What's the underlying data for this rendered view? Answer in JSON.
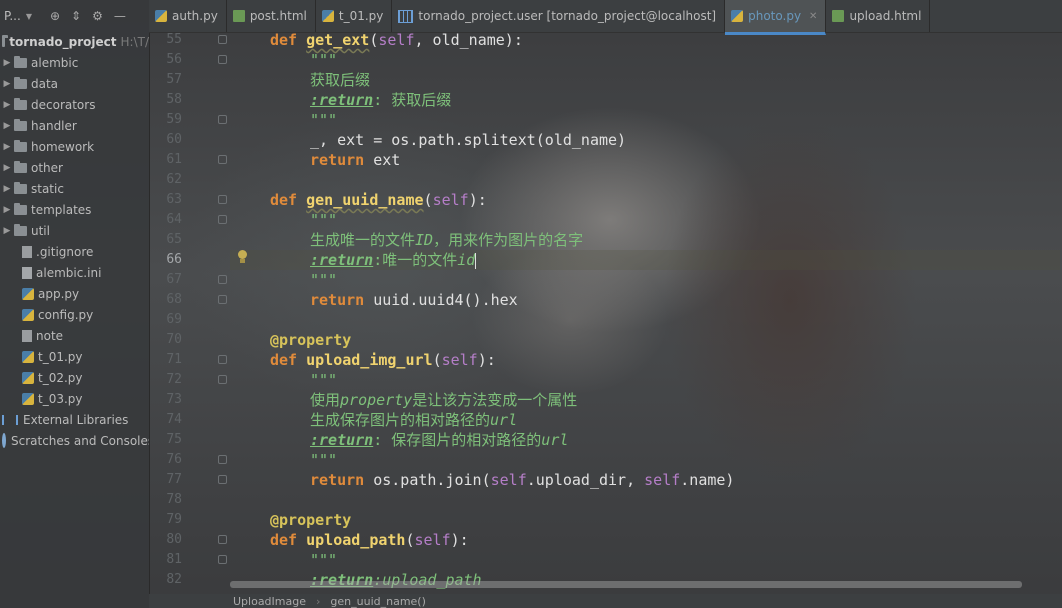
{
  "sidebar": {
    "header_title": "P...",
    "project": {
      "name": "tornado_project",
      "path": "H:\\T/"
    },
    "items": [
      {
        "label": "alembic",
        "type": "folder"
      },
      {
        "label": "data",
        "type": "folder"
      },
      {
        "label": "decorators",
        "type": "folder"
      },
      {
        "label": "handler",
        "type": "folder"
      },
      {
        "label": "homework",
        "type": "folder"
      },
      {
        "label": "other",
        "type": "folder"
      },
      {
        "label": "static",
        "type": "folder"
      },
      {
        "label": "templates",
        "type": "folder"
      },
      {
        "label": "util",
        "type": "folder"
      },
      {
        "label": ".gitignore",
        "type": "file"
      },
      {
        "label": "alembic.ini",
        "type": "ini"
      },
      {
        "label": "app.py",
        "type": "py"
      },
      {
        "label": "config.py",
        "type": "py"
      },
      {
        "label": "note",
        "type": "file"
      },
      {
        "label": "t_01.py",
        "type": "py"
      },
      {
        "label": "t_02.py",
        "type": "py"
      },
      {
        "label": "t_03.py",
        "type": "py"
      }
    ],
    "external_libraries": "External Libraries",
    "scratches": "Scratches and Consoles"
  },
  "tabs": [
    {
      "label": "auth.py",
      "icon": "python-file-icon",
      "active": false
    },
    {
      "label": "post.html",
      "icon": "html-file-icon",
      "active": false
    },
    {
      "label": "t_01.py",
      "icon": "python-file-icon",
      "active": false
    },
    {
      "label": "tornado_project.user [tornado_project@localhost]",
      "icon": "database-table-icon",
      "active": false
    },
    {
      "label": "photo.py",
      "icon": "python-file-icon",
      "active": true
    },
    {
      "label": "upload.html",
      "icon": "html-file-icon",
      "active": false
    }
  ],
  "editor": {
    "line_numbers": [
      "55",
      "56",
      "57",
      "58",
      "59",
      "60",
      "61",
      "62",
      "63",
      "64",
      "65",
      "66",
      "67",
      "68",
      "69",
      "70",
      "71",
      "72",
      "73",
      "74",
      "75",
      "76",
      "77",
      "78",
      "79",
      "80",
      "81",
      "82"
    ],
    "current_line": "66",
    "code": {
      "l55_def": "def ",
      "l55_name": "get_ext",
      "l55_open": "(",
      "l55_self": "self",
      "l55_rest": ", old_name):",
      "l56": "\"\"\"",
      "l57": "获取后缀",
      "l58_tag": ":return",
      "l58_text": ": 获取后缀",
      "l59": "\"\"\"",
      "l60": "_, ext = os.path.splitext(old_name)",
      "l61_kw": "return",
      "l61_rest": " ext",
      "l63_def": "def ",
      "l63_name": "gen_uuid_name",
      "l63_open": "(",
      "l63_self": "self",
      "l63_rest": "):",
      "l64": "\"\"\"",
      "l65_a": "生成唯一的文件",
      "l65_b": "ID",
      "l65_c": "，用来作为图片的名字",
      "l66_tag": ":return",
      "l66_a": ":",
      "l66_b": "唯一的文件",
      "l66_c": "id",
      "l67": "\"\"\"",
      "l68_kw": "return",
      "l68_rest": " uuid.uuid4().hex",
      "l70": "@property",
      "l71_def": "def ",
      "l71_name": "upload_img_url",
      "l71_open": "(",
      "l71_self": "self",
      "l71_rest": "):",
      "l72": "\"\"\"",
      "l73_a": "使用",
      "l73_b": "property",
      "l73_c": "是让该方法变成一个属性",
      "l74_a": "生成保存图片的相对路径的",
      "l74_b": "url",
      "l75_tag": ":return",
      "l75_a": ": 保存图片的相对路径的",
      "l75_b": "url",
      "l76": "\"\"\"",
      "l77_kw": "return",
      "l77_a": " os.path.join(",
      "l77_self1": "self",
      "l77_b": ".upload_dir, ",
      "l77_self2": "self",
      "l77_c": ".name)",
      "l79": "@property",
      "l80_def": "def ",
      "l80_name": "upload_path",
      "l80_open": "(",
      "l80_self": "self",
      "l80_rest": "):",
      "l81": "\"\"\"",
      "l82_tag": ":return",
      "l82_text": ":upload_path"
    }
  },
  "status_bar": {
    "class_crumb": "UploadImage",
    "method_crumb": "gen_uuid_name()"
  }
}
